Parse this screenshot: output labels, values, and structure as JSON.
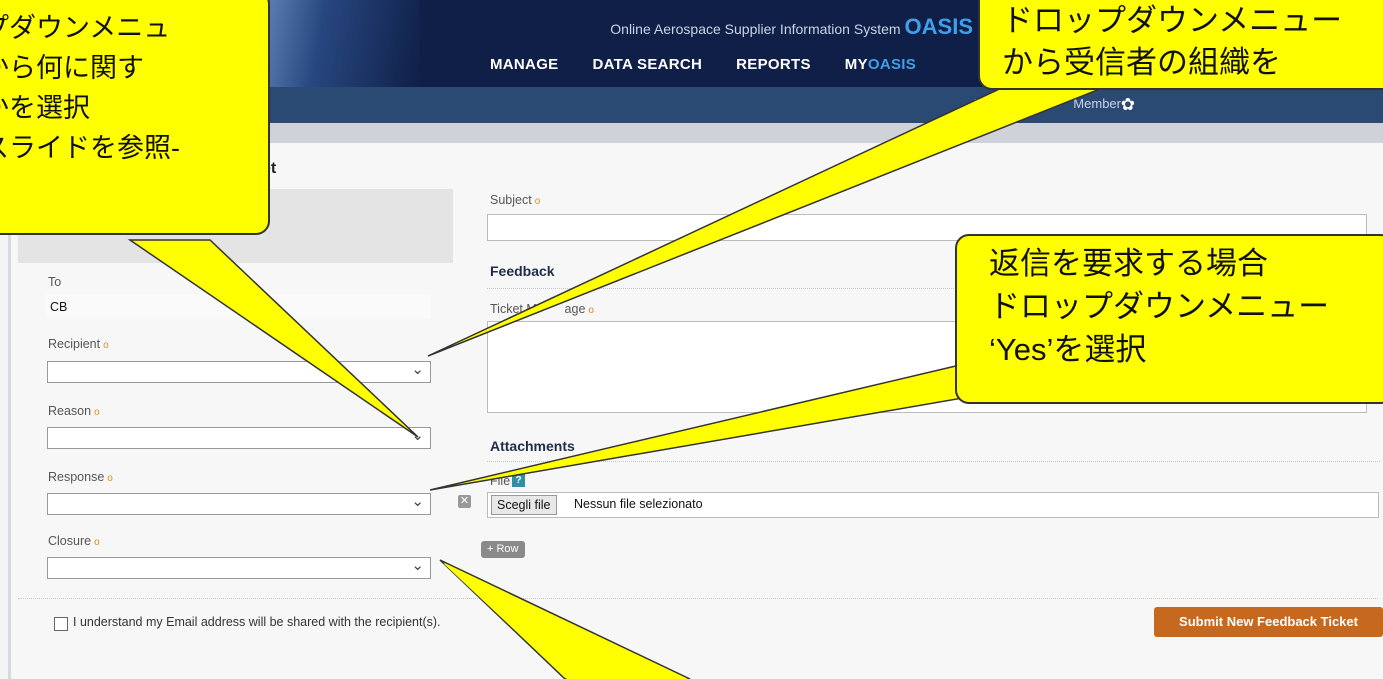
{
  "header": {
    "system_name": "Online Aerospace Supplier Information System",
    "brand": "OASIS",
    "nav": [
      "MANAGE",
      "DATA SEARCH",
      "REPORTS"
    ],
    "nav_my_prefix": "MY",
    "nav_my_suffix": "OASIS",
    "user_info": "Dem                    Member"
  },
  "page": {
    "title_fragment": "et"
  },
  "form": {
    "to_label": "To",
    "to_value": "CB",
    "recipient_label": "Recipient",
    "reason_label": "Reason",
    "response_label": "Response",
    "closure_label": "Closure",
    "subject_label": "Subject",
    "feedback_heading": "Feedback",
    "ticket_message_label": "Ticket M        age",
    "attachments_heading": "Attachments",
    "file_label": "File",
    "file_button": "Scegli file",
    "file_status": "Nessun file selezionato",
    "add_row": "+ Row",
    "consent_text": "I understand my Email address will be shared with the recipient(s).",
    "submit": "Submit New Feedback Ticket",
    "required_marker": "o",
    "help_marker": "?",
    "remove_marker": "✕"
  },
  "callouts": {
    "left": [
      "プダウンメニュ",
      "から何に関す",
      "かを選択",
      "スライドを参照-"
    ],
    "top_right": [
      "ドロップダウンメニュー",
      "から受信者の組織を"
    ],
    "right": [
      "返信を要求する場合",
      "ドロップダウンメニュー",
      "‘Yes’を選択"
    ]
  },
  "colors": {
    "header": "#0f1f47",
    "subbar": "#2b4a73",
    "brand": "#3fa0e8",
    "submit": "#c6681d",
    "callout": "#ffff00"
  },
  "icons": {
    "settings": "gear-icon",
    "help": "help-icon",
    "remove": "remove-icon",
    "dropdown": "chevron-down-icon"
  }
}
